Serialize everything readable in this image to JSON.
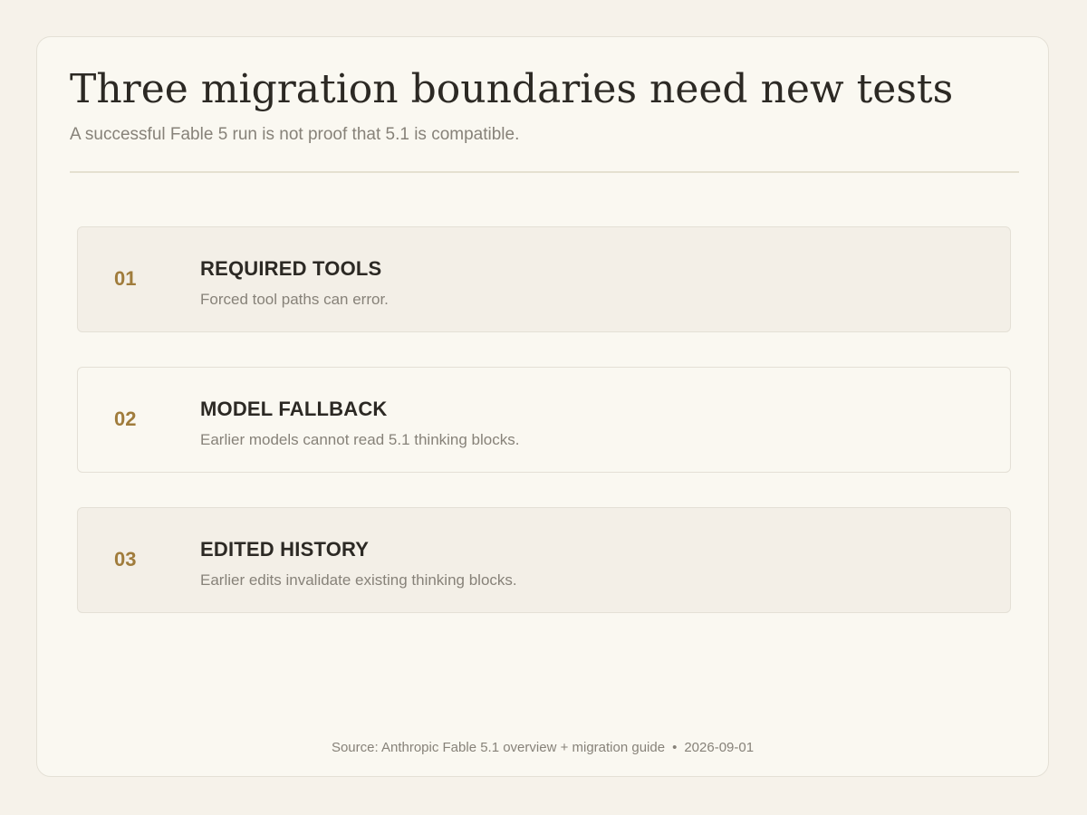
{
  "header": {
    "title": "Three migration boundaries need new tests",
    "subtitle": "A successful Fable 5 run is not proof that 5.1 is compatible."
  },
  "items": [
    {
      "number": "01",
      "heading": "REQUIRED TOOLS",
      "description": "Forced tool paths can error."
    },
    {
      "number": "02",
      "heading": "MODEL FALLBACK",
      "description": "Earlier models cannot read 5.1 thinking blocks."
    },
    {
      "number": "03",
      "heading": "EDITED HISTORY",
      "description": "Earlier edits invalidate existing thinking blocks."
    }
  ],
  "footer": {
    "source": "Source: Anthropic Fable 5.1 overview + migration guide",
    "separator": "•",
    "date": "2026-09-01"
  }
}
